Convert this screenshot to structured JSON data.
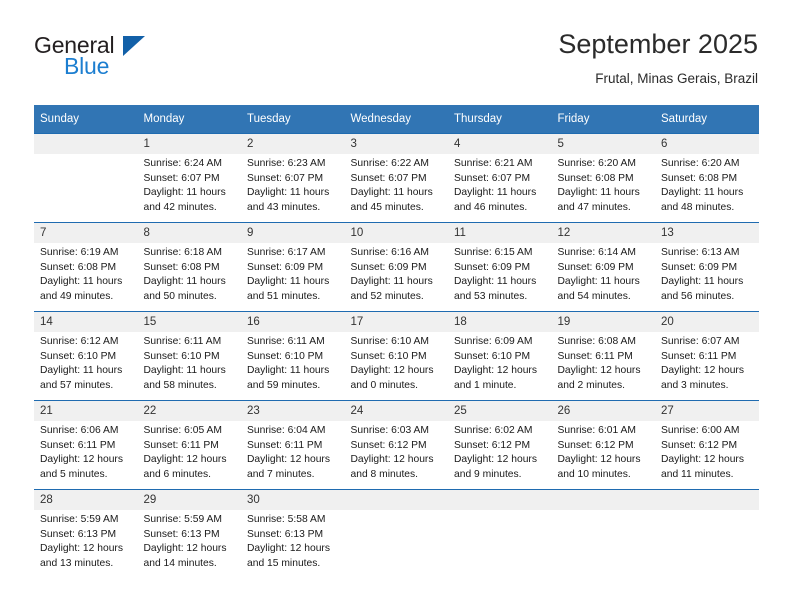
{
  "brand": {
    "word_one": "General",
    "word_two": "Blue",
    "triangle_icon": "triangle-icon",
    "accent_color": "#1c7ed0",
    "triangle_color": "#1260a8"
  },
  "header": {
    "title": "September 2025",
    "subtitle": "Frutal, Minas Gerais, Brazil"
  },
  "calendar": {
    "header_bg": "#3175b4",
    "row_divider_color": "#1f6bb0",
    "daynum_bg": "#f0f0f0",
    "weekday_headers": [
      "Sunday",
      "Monday",
      "Tuesday",
      "Wednesday",
      "Thursday",
      "Friday",
      "Saturday"
    ],
    "weeks": [
      [
        {
          "day": "",
          "sunrise": "",
          "sunset": "",
          "daylight": ""
        },
        {
          "day": "1",
          "sunrise": "Sunrise: 6:24 AM",
          "sunset": "Sunset: 6:07 PM",
          "daylight": "Daylight: 11 hours and 42 minutes."
        },
        {
          "day": "2",
          "sunrise": "Sunrise: 6:23 AM",
          "sunset": "Sunset: 6:07 PM",
          "daylight": "Daylight: 11 hours and 43 minutes."
        },
        {
          "day": "3",
          "sunrise": "Sunrise: 6:22 AM",
          "sunset": "Sunset: 6:07 PM",
          "daylight": "Daylight: 11 hours and 45 minutes."
        },
        {
          "day": "4",
          "sunrise": "Sunrise: 6:21 AM",
          "sunset": "Sunset: 6:07 PM",
          "daylight": "Daylight: 11 hours and 46 minutes."
        },
        {
          "day": "5",
          "sunrise": "Sunrise: 6:20 AM",
          "sunset": "Sunset: 6:08 PM",
          "daylight": "Daylight: 11 hours and 47 minutes."
        },
        {
          "day": "6",
          "sunrise": "Sunrise: 6:20 AM",
          "sunset": "Sunset: 6:08 PM",
          "daylight": "Daylight: 11 hours and 48 minutes."
        }
      ],
      [
        {
          "day": "7",
          "sunrise": "Sunrise: 6:19 AM",
          "sunset": "Sunset: 6:08 PM",
          "daylight": "Daylight: 11 hours and 49 minutes."
        },
        {
          "day": "8",
          "sunrise": "Sunrise: 6:18 AM",
          "sunset": "Sunset: 6:08 PM",
          "daylight": "Daylight: 11 hours and 50 minutes."
        },
        {
          "day": "9",
          "sunrise": "Sunrise: 6:17 AM",
          "sunset": "Sunset: 6:09 PM",
          "daylight": "Daylight: 11 hours and 51 minutes."
        },
        {
          "day": "10",
          "sunrise": "Sunrise: 6:16 AM",
          "sunset": "Sunset: 6:09 PM",
          "daylight": "Daylight: 11 hours and 52 minutes."
        },
        {
          "day": "11",
          "sunrise": "Sunrise: 6:15 AM",
          "sunset": "Sunset: 6:09 PM",
          "daylight": "Daylight: 11 hours and 53 minutes."
        },
        {
          "day": "12",
          "sunrise": "Sunrise: 6:14 AM",
          "sunset": "Sunset: 6:09 PM",
          "daylight": "Daylight: 11 hours and 54 minutes."
        },
        {
          "day": "13",
          "sunrise": "Sunrise: 6:13 AM",
          "sunset": "Sunset: 6:09 PM",
          "daylight": "Daylight: 11 hours and 56 minutes."
        }
      ],
      [
        {
          "day": "14",
          "sunrise": "Sunrise: 6:12 AM",
          "sunset": "Sunset: 6:10 PM",
          "daylight": "Daylight: 11 hours and 57 minutes."
        },
        {
          "day": "15",
          "sunrise": "Sunrise: 6:11 AM",
          "sunset": "Sunset: 6:10 PM",
          "daylight": "Daylight: 11 hours and 58 minutes."
        },
        {
          "day": "16",
          "sunrise": "Sunrise: 6:11 AM",
          "sunset": "Sunset: 6:10 PM",
          "daylight": "Daylight: 11 hours and 59 minutes."
        },
        {
          "day": "17",
          "sunrise": "Sunrise: 6:10 AM",
          "sunset": "Sunset: 6:10 PM",
          "daylight": "Daylight: 12 hours and 0 minutes."
        },
        {
          "day": "18",
          "sunrise": "Sunrise: 6:09 AM",
          "sunset": "Sunset: 6:10 PM",
          "daylight": "Daylight: 12 hours and 1 minute."
        },
        {
          "day": "19",
          "sunrise": "Sunrise: 6:08 AM",
          "sunset": "Sunset: 6:11 PM",
          "daylight": "Daylight: 12 hours and 2 minutes."
        },
        {
          "day": "20",
          "sunrise": "Sunrise: 6:07 AM",
          "sunset": "Sunset: 6:11 PM",
          "daylight": "Daylight: 12 hours and 3 minutes."
        }
      ],
      [
        {
          "day": "21",
          "sunrise": "Sunrise: 6:06 AM",
          "sunset": "Sunset: 6:11 PM",
          "daylight": "Daylight: 12 hours and 5 minutes."
        },
        {
          "day": "22",
          "sunrise": "Sunrise: 6:05 AM",
          "sunset": "Sunset: 6:11 PM",
          "daylight": "Daylight: 12 hours and 6 minutes."
        },
        {
          "day": "23",
          "sunrise": "Sunrise: 6:04 AM",
          "sunset": "Sunset: 6:11 PM",
          "daylight": "Daylight: 12 hours and 7 minutes."
        },
        {
          "day": "24",
          "sunrise": "Sunrise: 6:03 AM",
          "sunset": "Sunset: 6:12 PM",
          "daylight": "Daylight: 12 hours and 8 minutes."
        },
        {
          "day": "25",
          "sunrise": "Sunrise: 6:02 AM",
          "sunset": "Sunset: 6:12 PM",
          "daylight": "Daylight: 12 hours and 9 minutes."
        },
        {
          "day": "26",
          "sunrise": "Sunrise: 6:01 AM",
          "sunset": "Sunset: 6:12 PM",
          "daylight": "Daylight: 12 hours and 10 minutes."
        },
        {
          "day": "27",
          "sunrise": "Sunrise: 6:00 AM",
          "sunset": "Sunset: 6:12 PM",
          "daylight": "Daylight: 12 hours and 11 minutes."
        }
      ],
      [
        {
          "day": "28",
          "sunrise": "Sunrise: 5:59 AM",
          "sunset": "Sunset: 6:13 PM",
          "daylight": "Daylight: 12 hours and 13 minutes."
        },
        {
          "day": "29",
          "sunrise": "Sunrise: 5:59 AM",
          "sunset": "Sunset: 6:13 PM",
          "daylight": "Daylight: 12 hours and 14 minutes."
        },
        {
          "day": "30",
          "sunrise": "Sunrise: 5:58 AM",
          "sunset": "Sunset: 6:13 PM",
          "daylight": "Daylight: 12 hours and 15 minutes."
        },
        {
          "day": "",
          "sunrise": "",
          "sunset": "",
          "daylight": ""
        },
        {
          "day": "",
          "sunrise": "",
          "sunset": "",
          "daylight": ""
        },
        {
          "day": "",
          "sunrise": "",
          "sunset": "",
          "daylight": ""
        },
        {
          "day": "",
          "sunrise": "",
          "sunset": "",
          "daylight": ""
        }
      ]
    ]
  }
}
